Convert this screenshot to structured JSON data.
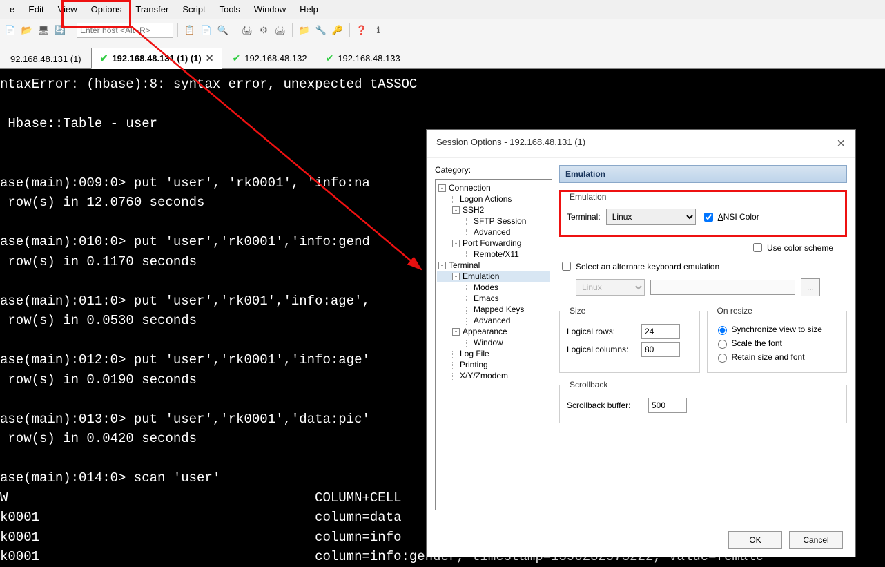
{
  "menubar": {
    "items": [
      "e",
      "Edit",
      "View",
      "Options",
      "Transfer",
      "Script",
      "Tools",
      "Window",
      "Help"
    ]
  },
  "toolbar": {
    "host_placeholder": "Enter host <Alt+R>"
  },
  "tabs": [
    {
      "label": "92.168.48.131 (1)",
      "active": false,
      "closable": false,
      "check": false
    },
    {
      "label": "192.168.48.131 (1) (1)",
      "active": true,
      "closable": true,
      "check": true
    },
    {
      "label": "192.168.48.132",
      "active": false,
      "closable": false,
      "check": true
    },
    {
      "label": "192.168.48.133",
      "active": false,
      "closable": false,
      "check": true
    }
  ],
  "terminal_lines": [
    "ntaxError: (hbase):8: syntax error, unexpected tASSOC",
    "",
    " Hbase::Table - user",
    "",
    "",
    "ase(main):009:0> put 'user', 'rk0001', 'info:na",
    " row(s) in 12.0760 seconds",
    "",
    "ase(main):010:0> put 'user','rk0001','info:gend",
    " row(s) in 0.1170 seconds",
    "",
    "ase(main):011:0> put 'user','rk001','info:age',",
    " row(s) in 0.0530 seconds",
    "",
    "ase(main):012:0> put 'user','rk0001','info:age'",
    " row(s) in 0.0190 seconds",
    "",
    "ase(main):013:0> put 'user','rk0001','data:pic'",
    " row(s) in 0.0420 seconds",
    "",
    "ase(main):014:0> scan 'user'",
    "W                                       COLUMN+CELL",
    "k0001                                   column=data",
    "k0001                                   column=info",
    "k0001                                   column=info:gender, timestamp=1590232975222, value=female"
  ],
  "dialog": {
    "title": "Session Options - 192.168.48.131 (1)",
    "category_label": "Category:",
    "tree": [
      {
        "label": "Connection",
        "indent": 0,
        "toggle": "-"
      },
      {
        "label": "Logon Actions",
        "indent": 1
      },
      {
        "label": "SSH2",
        "indent": 1,
        "toggle": "-"
      },
      {
        "label": "SFTP Session",
        "indent": 2
      },
      {
        "label": "Advanced",
        "indent": 2
      },
      {
        "label": "Port Forwarding",
        "indent": 1,
        "toggle": "-"
      },
      {
        "label": "Remote/X11",
        "indent": 2
      },
      {
        "label": "Terminal",
        "indent": 0,
        "toggle": "-"
      },
      {
        "label": "Emulation",
        "indent": 1,
        "toggle": "-",
        "selected": true
      },
      {
        "label": "Modes",
        "indent": 2
      },
      {
        "label": "Emacs",
        "indent": 2
      },
      {
        "label": "Mapped Keys",
        "indent": 2
      },
      {
        "label": "Advanced",
        "indent": 2
      },
      {
        "label": "Appearance",
        "indent": 1,
        "toggle": "-"
      },
      {
        "label": "Window",
        "indent": 2
      },
      {
        "label": "Log File",
        "indent": 1
      },
      {
        "label": "Printing",
        "indent": 1
      },
      {
        "label": "X/Y/Zmodem",
        "indent": 1
      }
    ],
    "right": {
      "header": "Emulation",
      "emu_legend": "Emulation",
      "terminal_label": "Terminal:",
      "terminal_value": "Linux",
      "ansi_color": "ANSI Color",
      "use_color_scheme": "Use color scheme",
      "alt_kbd": "Select an alternate keyboard emulation",
      "alt_kbd_value": "Linux",
      "browse_btn": "...",
      "size_legend": "Size",
      "rows_label": "Logical rows:",
      "rows_value": "24",
      "cols_label": "Logical columns:",
      "cols_value": "80",
      "resize_legend": "On resize",
      "resize_opts": [
        "Synchronize view to size",
        "Scale the font",
        "Retain size and font"
      ],
      "scroll_legend": "Scrollback",
      "scroll_label": "Scrollback buffer:",
      "scroll_value": "500"
    },
    "ok": "OK",
    "cancel": "Cancel"
  }
}
